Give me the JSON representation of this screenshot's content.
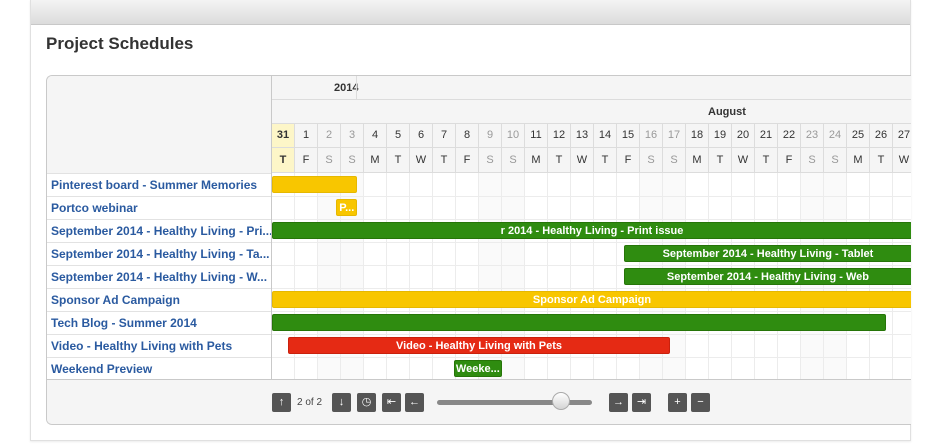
{
  "page": {
    "title": "Project Schedules"
  },
  "timeline": {
    "year": "2014",
    "month": "August",
    "days": [
      {
        "num": "31",
        "dow": "T",
        "weekend": false,
        "today": true
      },
      {
        "num": "1",
        "dow": "F",
        "weekend": false
      },
      {
        "num": "2",
        "dow": "S",
        "weekend": true
      },
      {
        "num": "3",
        "dow": "S",
        "weekend": true
      },
      {
        "num": "4",
        "dow": "M",
        "weekend": false
      },
      {
        "num": "5",
        "dow": "T",
        "weekend": false
      },
      {
        "num": "6",
        "dow": "W",
        "weekend": false
      },
      {
        "num": "7",
        "dow": "T",
        "weekend": false
      },
      {
        "num": "8",
        "dow": "F",
        "weekend": false
      },
      {
        "num": "9",
        "dow": "S",
        "weekend": true
      },
      {
        "num": "10",
        "dow": "S",
        "weekend": true
      },
      {
        "num": "11",
        "dow": "M",
        "weekend": false
      },
      {
        "num": "12",
        "dow": "T",
        "weekend": false
      },
      {
        "num": "13",
        "dow": "W",
        "weekend": false
      },
      {
        "num": "14",
        "dow": "T",
        "weekend": false
      },
      {
        "num": "15",
        "dow": "F",
        "weekend": false
      },
      {
        "num": "16",
        "dow": "S",
        "weekend": true
      },
      {
        "num": "17",
        "dow": "S",
        "weekend": true
      },
      {
        "num": "18",
        "dow": "M",
        "weekend": false
      },
      {
        "num": "19",
        "dow": "T",
        "weekend": false
      },
      {
        "num": "20",
        "dow": "W",
        "weekend": false
      },
      {
        "num": "21",
        "dow": "T",
        "weekend": false
      },
      {
        "num": "22",
        "dow": "F",
        "weekend": false
      },
      {
        "num": "23",
        "dow": "S",
        "weekend": true
      },
      {
        "num": "24",
        "dow": "S",
        "weekend": true
      },
      {
        "num": "25",
        "dow": "M",
        "weekend": false
      },
      {
        "num": "26",
        "dow": "T",
        "weekend": false
      },
      {
        "num": "27",
        "dow": "W",
        "weekend": false
      }
    ]
  },
  "tasks": [
    {
      "label": "Pinterest board - Summer Memories",
      "bar_text": "",
      "color": "yellow",
      "start": 0,
      "end": 3.7
    },
    {
      "label": "Portco webinar",
      "bar_text": "P...",
      "color": "yellow",
      "start": 2.8,
      "end": 3.7
    },
    {
      "label": "September 2014 - Healthy Living - Print issue",
      "bar_text": "r 2014 - Healthy Living - Print issue",
      "color": "green",
      "start": 0,
      "end": 28
    },
    {
      "label": "September 2014 - Healthy Living - Tablet",
      "bar_text": "September 2014 - Healthy Living - Tablet",
      "color": "green",
      "start": 15.3,
      "end": 28
    },
    {
      "label": "September 2014 - Healthy Living - Web",
      "bar_text": "September 2014 - Healthy Living - Web",
      "color": "green",
      "start": 15.3,
      "end": 28
    },
    {
      "label": "Sponsor Ad Campaign",
      "bar_text": "Sponsor Ad Campaign",
      "color": "yellow",
      "start": 0,
      "end": 28
    },
    {
      "label": "Tech Blog - Summer 2014",
      "bar_text": "",
      "color": "green",
      "start": 0,
      "end": 26.7
    },
    {
      "label": "Video - Healthy Living with Pets",
      "bar_text": "Video - Healthy Living with Pets",
      "color": "red",
      "start": 0.7,
      "end": 17.3
    },
    {
      "label": "Weekend Preview",
      "bar_text": "Weeke...",
      "color": "green",
      "start": 7.9,
      "end": 10
    }
  ],
  "labels_display": [
    "Pinterest board - Summer Memories",
    "Portco webinar",
    "September 2014 - Healthy Living - Pri...",
    "September 2014 - Healthy Living - Ta...",
    "September 2014 - Healthy Living - W...",
    "Sponsor Ad Campaign",
    "Tech Blog - Summer 2014",
    "Video - Healthy Living with Pets",
    "Weekend Preview"
  ],
  "footer": {
    "pager_text": "2 of 2",
    "icons": [
      "arrow-up-icon",
      "arrow-down-icon",
      "clock-icon",
      "first-page-icon",
      "prev-icon",
      "next-icon",
      "last-page-icon",
      "zoom-in-icon",
      "zoom-out-icon"
    ]
  }
}
